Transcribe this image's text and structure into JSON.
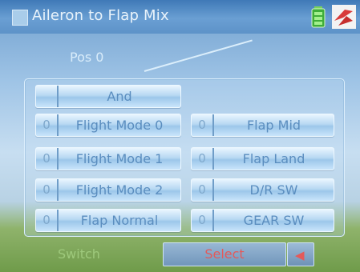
{
  "header": {
    "title": "Aileron to Flap Mix",
    "icons": [
      "battery-icon",
      "logo-icon"
    ]
  },
  "pos_label": "Pos 0",
  "panel": {
    "and_label": "And",
    "buttons": [
      {
        "num": "0",
        "label": "Flight Mode 0"
      },
      {
        "num": "0",
        "label": "Flap Mid"
      },
      {
        "num": "0",
        "label": "Flight Mode 1"
      },
      {
        "num": "0",
        "label": "Flap Land"
      },
      {
        "num": "0",
        "label": "Flight Mode 2"
      },
      {
        "num": "0",
        "label": "D/R SW"
      },
      {
        "num": "0",
        "label": "Flap Normal"
      },
      {
        "num": "0",
        "label": "GEAR SW"
      }
    ]
  },
  "footer": {
    "switch_label": "Switch",
    "select_label": "Select",
    "back_icon": "back-arrow-icon"
  },
  "colors": {
    "accent_red": "#e35a5a",
    "title_bar": "#4f86c0"
  }
}
